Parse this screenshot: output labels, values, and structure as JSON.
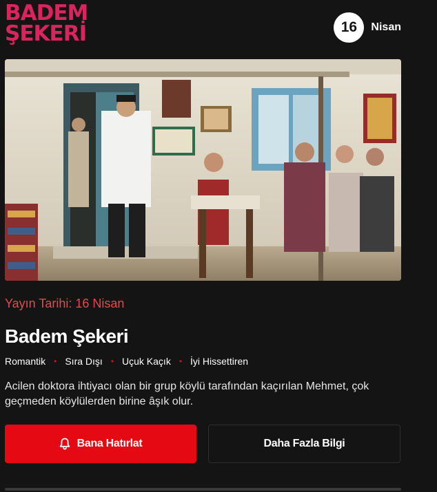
{
  "logo": {
    "line1": "BADEM",
    "line2": "ŞEKERİ"
  },
  "release_badge": {
    "day": "16",
    "month": "Nisan"
  },
  "hero": {
    "alt": "Badem Şekeri scene in village courtyard"
  },
  "release_text": "Yayın Tarihi: 16 Nisan",
  "title": "Badem Şekeri",
  "tags": [
    "Romantik",
    "Sıra Dışı",
    "Uçuk Kaçık",
    "İyi Hissettiren"
  ],
  "description": "Acilen doktora ihtiyacı olan bir grup köylü tarafından kaçırılan Mehmet, çok geçmeden köylülerden birine âşık olur.",
  "buttons": {
    "remind": "Bana Hatırlat",
    "more_info": "Daha Fazla Bilgi"
  },
  "icons": {
    "remind": "bell-icon"
  },
  "colors": {
    "accent": "#e50914",
    "logo": "#d8255f",
    "release": "#e5494f"
  }
}
